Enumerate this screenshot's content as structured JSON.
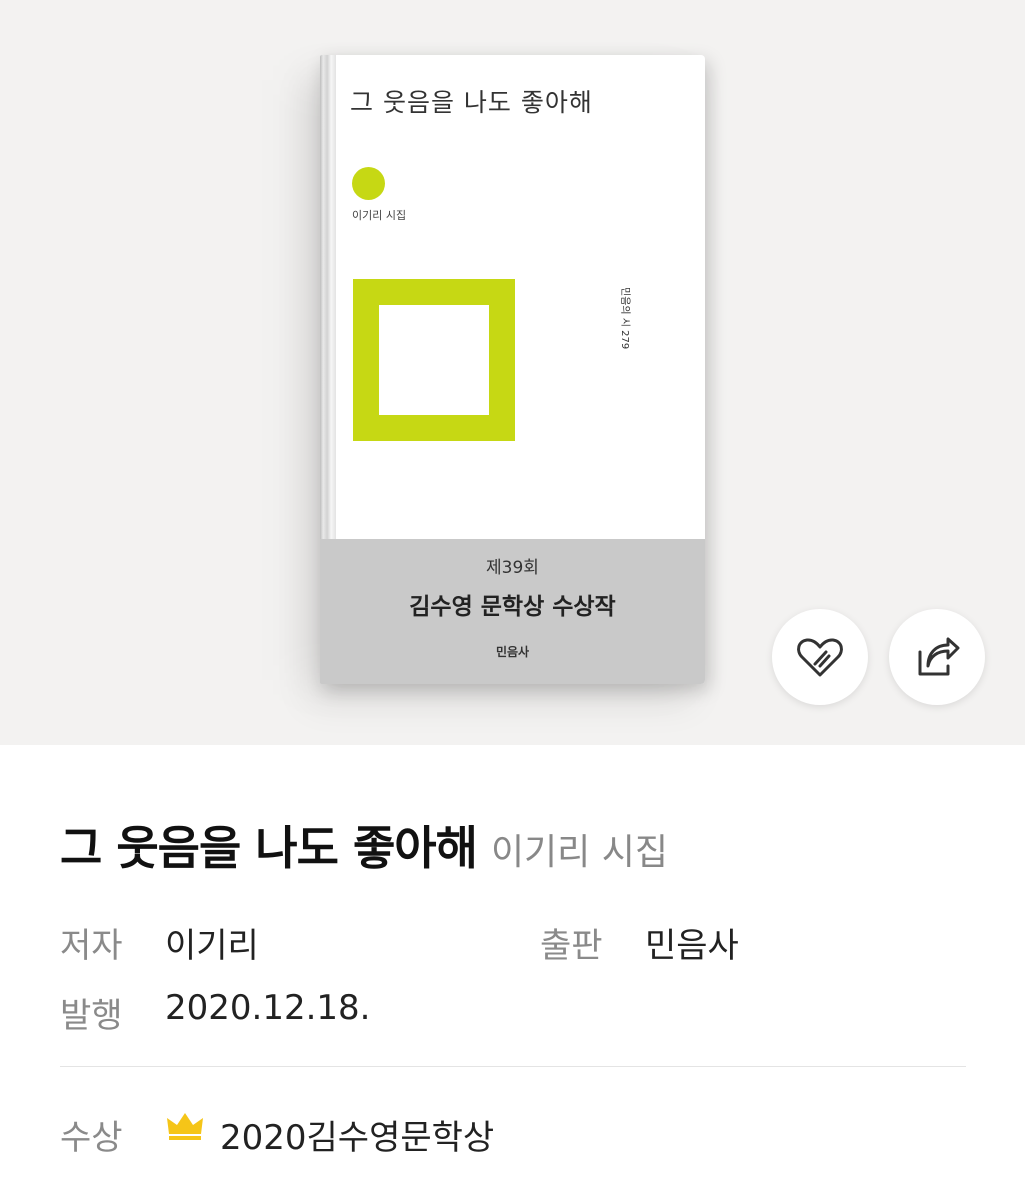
{
  "cover": {
    "title": "그 웃음을 나도 좋아해",
    "subtitle": "이기리 시집",
    "series": "민음의 시 279",
    "award_line1": "제39회",
    "award_line2": "김수영 문학상 수상작",
    "publisher": "민음사",
    "accent_color": "#c6d814",
    "band_color": "#c9c9c9"
  },
  "actions": {
    "like_icon": "heart-icon",
    "share_icon": "share-icon"
  },
  "book": {
    "title": "그 웃음을 나도 좋아해",
    "subtitle": "이기리 시집"
  },
  "meta": {
    "author_label": "저자",
    "author": "이기리",
    "publisher_label": "출판",
    "publisher": "민음사",
    "date_label": "발행",
    "date": "2020.12.18.",
    "award_label": "수상",
    "award": "2020김수영문학상",
    "award_icon": "crown-icon",
    "crown_color": "#f5c518"
  }
}
